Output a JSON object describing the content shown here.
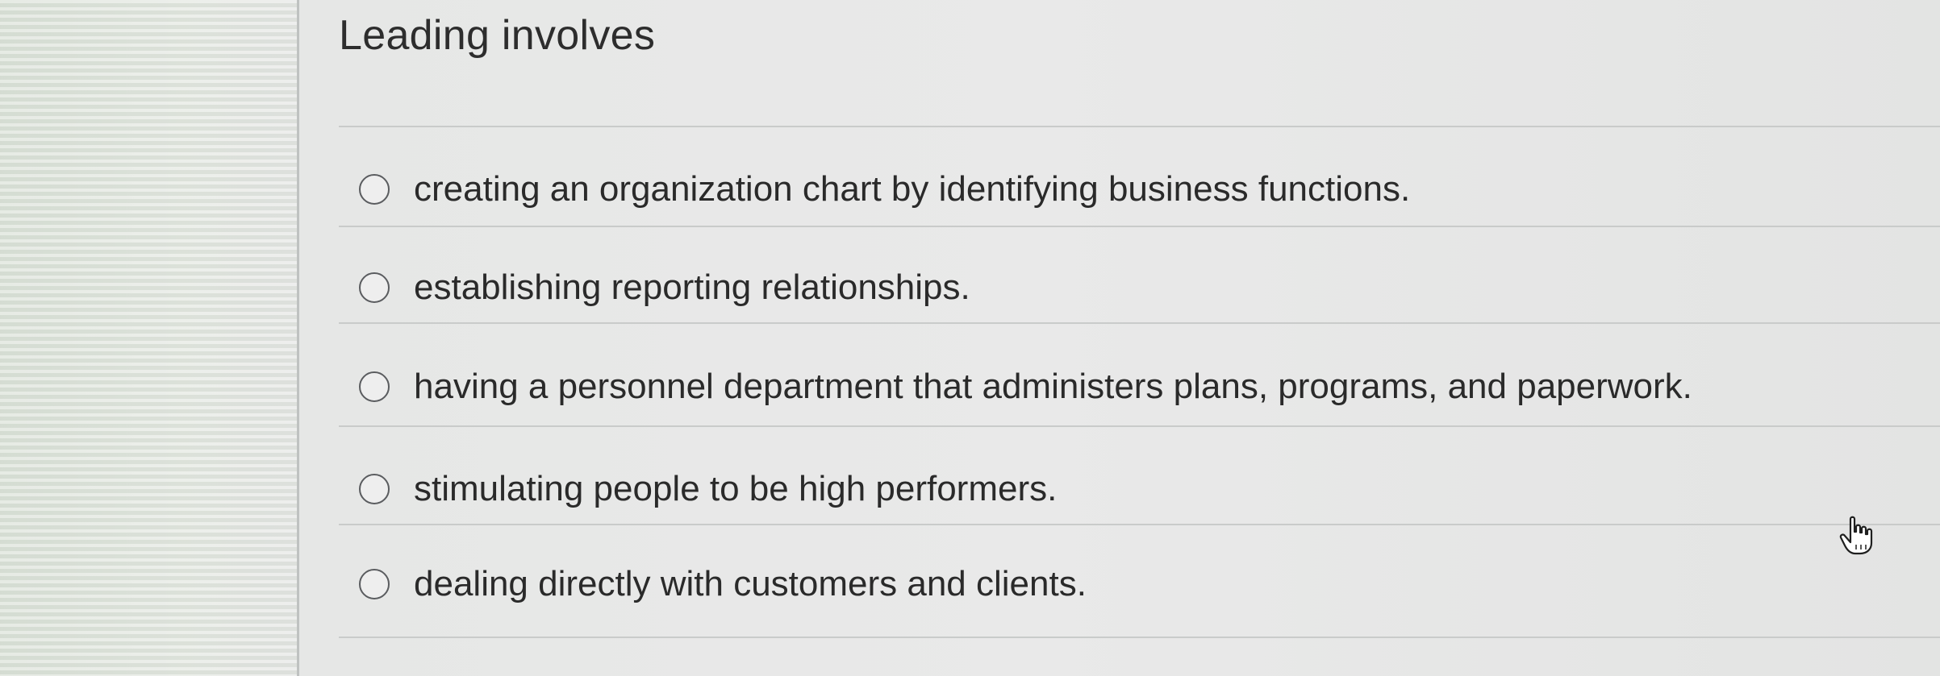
{
  "question": {
    "title": "Leading involves"
  },
  "options": [
    {
      "label": "creating an organization chart by identifying business functions.",
      "selected": false
    },
    {
      "label": "establishing reporting relationships.",
      "selected": false
    },
    {
      "label": "having a personnel department that administers plans, programs, and paperwork.",
      "selected": false
    },
    {
      "label": "stimulating people to be high performers.",
      "selected": false
    },
    {
      "label": "dealing directly with customers and clients.",
      "selected": false
    }
  ],
  "icons": {
    "radio": "radio-unselected-icon",
    "cursor": "hand-pointer-icon"
  },
  "colors": {
    "text": "#2a2a2a",
    "divider": "#c9cbca",
    "radio_border": "#5a5c5f"
  }
}
